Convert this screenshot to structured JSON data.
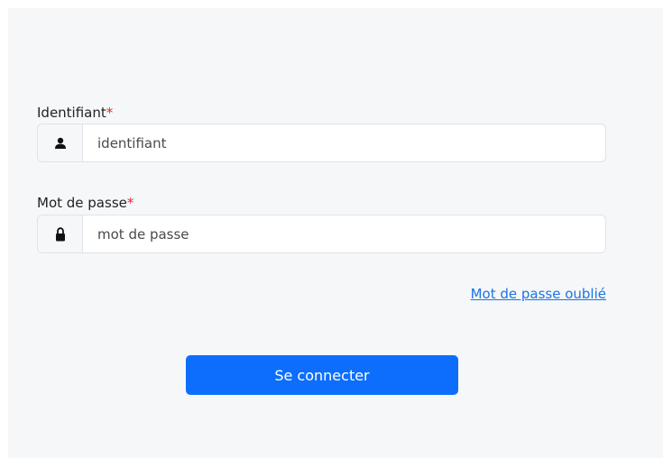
{
  "form": {
    "username": {
      "label": "Identifiant",
      "required_mark": "*",
      "placeholder": "identifiant",
      "value": "",
      "icon": "user-icon"
    },
    "password": {
      "label": "Mot de passe",
      "required_mark": "*",
      "placeholder": "mot de passe",
      "value": "",
      "icon": "lock-icon"
    },
    "forgot_password_link": "Mot de passe oublié",
    "submit_label": "Se connecter"
  },
  "colors": {
    "panel_background": "#f5f7f9",
    "required": "#e0282e",
    "link": "#1b74e4",
    "primary_button": "#0d6efd"
  }
}
